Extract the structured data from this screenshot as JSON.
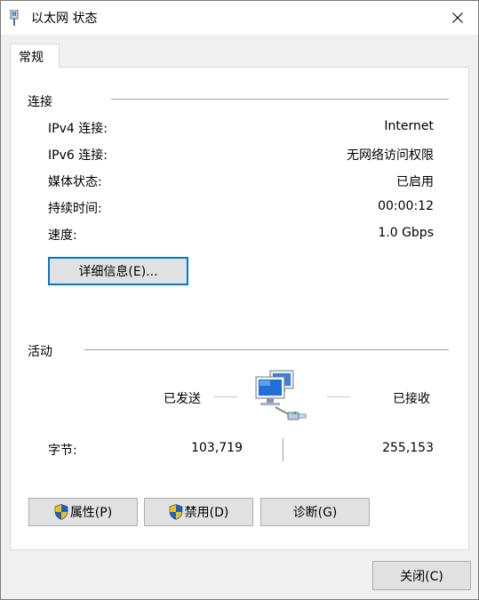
{
  "window": {
    "title": "以太网 状态",
    "close_glyph": "✕"
  },
  "tabs": [
    {
      "label": "常规"
    }
  ],
  "connection": {
    "group_label": "连接",
    "rows": [
      {
        "label": "IPv4 连接:",
        "value": "Internet"
      },
      {
        "label": "IPv6 连接:",
        "value": "无网络访问权限"
      },
      {
        "label": "媒体状态:",
        "value": "已启用"
      },
      {
        "label": "持续时间:",
        "value": "00:00:12"
      },
      {
        "label": "速度:",
        "value": "1.0 Gbps"
      }
    ],
    "details_button": "详细信息(E)..."
  },
  "activity": {
    "group_label": "活动",
    "sent_label": "已发送",
    "received_label": "已接收",
    "bytes_label": "字节:",
    "bytes_sent": "103,719",
    "bytes_received": "255,153"
  },
  "actions": {
    "properties": "属性(P)",
    "disable": "禁用(D)",
    "diagnose": "诊断(G)"
  },
  "footer": {
    "close": "关闭(C)"
  },
  "colors": {
    "focus_border": "#0078d7",
    "button_face": "#e1e1e1",
    "shield_blue": "#1f5fbf",
    "shield_yellow": "#f2c011"
  }
}
